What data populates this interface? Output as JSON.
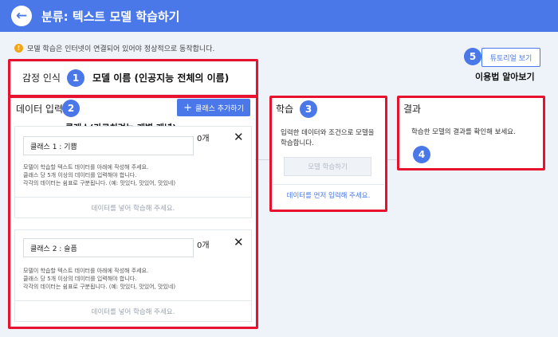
{
  "header": {
    "back_icon": "arrow-left-icon",
    "title": "분류: 텍스트 모델 학습하기"
  },
  "notice": {
    "icon": "warning-icon",
    "text": "모델 학습은 인터넷이 연결되어 있어야 정상적으로 동작합니다."
  },
  "model": {
    "name": "감정 인식",
    "annotation": "모델 이름 (인공지능 전체의 이름)"
  },
  "data_input": {
    "title": "데이터 입력",
    "add_class_label": "클래스 추가하기",
    "class_annotation": "클래스(가르치려는 개별 개념)",
    "classes": [
      {
        "name": "클래스 1 : 기쁨",
        "count": "0개",
        "instr1": "모델이 학습할 텍스트 데이터를 아래에 작성해 주세요.",
        "instr2": "클래스 당 5개 이상의 데이터를 입력해야 합니다.",
        "instr3": "각각의 데이터는 쉼표로 구분됩니다. (예: 맛있다, 맛있어, 맛있네)",
        "footer": "데이터를 넣어 학습해 주세요."
      },
      {
        "name": "클래스 2 : 슬픔",
        "count": "0개",
        "instr1": "모델이 학습할 텍스트 데이터를 아래에 작성해 주세요.",
        "instr2": "클래스 당 5개 이상의 데이터를 입력해야 합니다.",
        "instr3": "각각의 데이터는 쉼표로 구분됩니다. (예: 맛있다, 맛있어, 맛있네)",
        "footer": "데이터를 넣어 학습해 주세요."
      }
    ]
  },
  "training": {
    "title": "학습",
    "description": "입력한 데이터와 조건으로 모델을 학습합니다.",
    "button": "모델 학습하기",
    "hint": "데이터를 먼저 입력해 주세요."
  },
  "result": {
    "title": "결과",
    "description": "학습한 모델의 결과를 확인해 보세요."
  },
  "tutorial": {
    "button": "튜토리얼 보기",
    "annotation": "이용법 알아보기"
  },
  "badges": {
    "b1": "1",
    "b2": "2",
    "b3": "3",
    "b4": "4",
    "b5": "5"
  },
  "close_symbol": "✕",
  "colors": {
    "primary": "#4a78e8",
    "highlight": "#e8122e",
    "warning": "#f2a518",
    "canvas": "#eef3fa"
  }
}
